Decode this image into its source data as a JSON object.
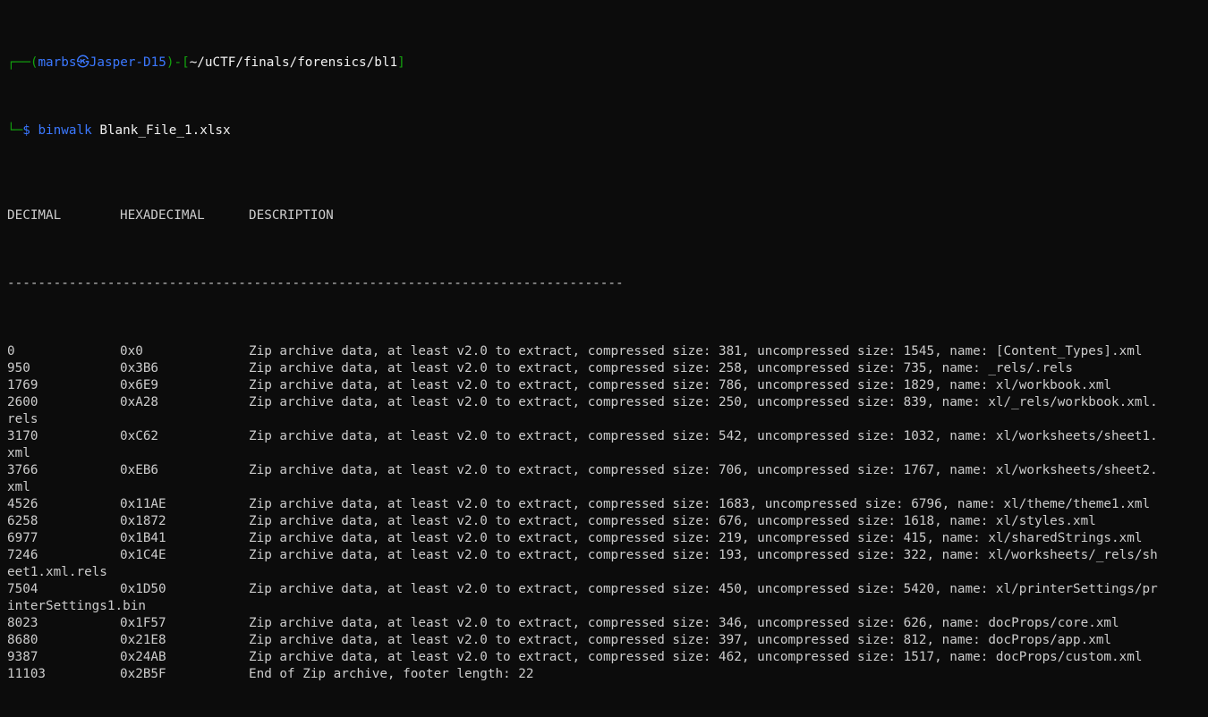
{
  "prompt": {
    "corner_top": "┌──",
    "paren_open": "(",
    "user": "marbs",
    "at_icon": "㉿",
    "host": "Jasper-D15",
    "paren_close": ")",
    "dash": "-",
    "bracket_open": "[",
    "path": "~/uCTF/finals/forensics/bl1",
    "bracket_close": "]",
    "corner_bottom": "└─",
    "dollar": "$",
    "command": "binwalk",
    "argument": "Blank_File_1.xlsx"
  },
  "table": {
    "headers": [
      "DECIMAL",
      "HEXADECIMAL",
      "DESCRIPTION"
    ],
    "separator": "--------------------------------------------------------------------------------",
    "rows": [
      {
        "decimal": "0",
        "hex": "0x0",
        "desc": "Zip archive data, at least v2.0 to extract, compressed size: 381, uncompressed size: 1545, name: [Content_Types].xml",
        "wrap": ""
      },
      {
        "decimal": "950",
        "hex": "0x3B6",
        "desc": "Zip archive data, at least v2.0 to extract, compressed size: 258, uncompressed size: 735, name: _rels/.rels",
        "wrap": ""
      },
      {
        "decimal": "1769",
        "hex": "0x6E9",
        "desc": "Zip archive data, at least v2.0 to extract, compressed size: 786, uncompressed size: 1829, name: xl/workbook.xml",
        "wrap": ""
      },
      {
        "decimal": "2600",
        "hex": "0xA28",
        "desc": "Zip archive data, at least v2.0 to extract, compressed size: 250, uncompressed size: 839, name: xl/_rels/workbook.xml.",
        "wrap": "rels"
      },
      {
        "decimal": "3170",
        "hex": "0xC62",
        "desc": "Zip archive data, at least v2.0 to extract, compressed size: 542, uncompressed size: 1032, name: xl/worksheets/sheet1.",
        "wrap": "xml"
      },
      {
        "decimal": "3766",
        "hex": "0xEB6",
        "desc": "Zip archive data, at least v2.0 to extract, compressed size: 706, uncompressed size: 1767, name: xl/worksheets/sheet2.",
        "wrap": "xml"
      },
      {
        "decimal": "4526",
        "hex": "0x11AE",
        "desc": "Zip archive data, at least v2.0 to extract, compressed size: 1683, uncompressed size: 6796, name: xl/theme/theme1.xml",
        "wrap": ""
      },
      {
        "decimal": "6258",
        "hex": "0x1872",
        "desc": "Zip archive data, at least v2.0 to extract, compressed size: 676, uncompressed size: 1618, name: xl/styles.xml",
        "wrap": ""
      },
      {
        "decimal": "6977",
        "hex": "0x1B41",
        "desc": "Zip archive data, at least v2.0 to extract, compressed size: 219, uncompressed size: 415, name: xl/sharedStrings.xml",
        "wrap": ""
      },
      {
        "decimal": "7246",
        "hex": "0x1C4E",
        "desc": "Zip archive data, at least v2.0 to extract, compressed size: 193, uncompressed size: 322, name: xl/worksheets/_rels/sh",
        "wrap": "eet1.xml.rels"
      },
      {
        "decimal": "7504",
        "hex": "0x1D50",
        "desc": "Zip archive data, at least v2.0 to extract, compressed size: 450, uncompressed size: 5420, name: xl/printerSettings/pr",
        "wrap": "interSettings1.bin"
      },
      {
        "decimal": "8023",
        "hex": "0x1F57",
        "desc": "Zip archive data, at least v2.0 to extract, compressed size: 346, uncompressed size: 626, name: docProps/core.xml",
        "wrap": ""
      },
      {
        "decimal": "8680",
        "hex": "0x21E8",
        "desc": "Zip archive data, at least v2.0 to extract, compressed size: 397, uncompressed size: 812, name: docProps/app.xml",
        "wrap": ""
      },
      {
        "decimal": "9387",
        "hex": "0x24AB",
        "desc": "Zip archive data, at least v2.0 to extract, compressed size: 462, uncompressed size: 1517, name: docProps/custom.xml",
        "wrap": ""
      },
      {
        "decimal": "11103",
        "hex": "0x2B5F",
        "desc": "End of Zip archive, footer length: 22",
        "wrap": ""
      }
    ]
  },
  "colors": {
    "background": "#0c0c0c",
    "text": "#cccccc",
    "prompt_green": "#13a10e",
    "prompt_blue": "#3b78ff",
    "bright_white": "#f2f2f2"
  }
}
